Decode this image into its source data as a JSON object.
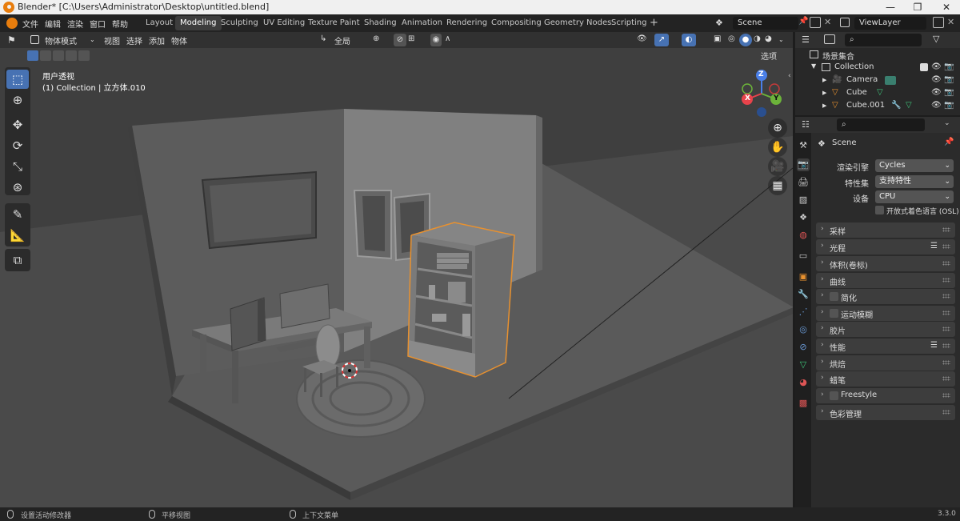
{
  "window": {
    "title": "Blender* [C:\\Users\\Administrator\\Desktop\\untitled.blend]",
    "minimize": "—",
    "maximize": "❐",
    "close": "✕"
  },
  "menu": [
    "文件",
    "编辑",
    "渲染",
    "窗口",
    "帮助"
  ],
  "workspaces": [
    {
      "label": "Layout",
      "active": false
    },
    {
      "label": "Modeling",
      "active": true
    },
    {
      "label": "Sculpting",
      "active": false
    },
    {
      "label": "UV Editing",
      "active": false
    },
    {
      "label": "Texture Paint",
      "active": false
    },
    {
      "label": "Shading",
      "active": false
    },
    {
      "label": "Animation",
      "active": false
    },
    {
      "label": "Rendering",
      "active": false
    },
    {
      "label": "Compositing",
      "active": false
    },
    {
      "label": "Geometry Nodes",
      "active": false
    },
    {
      "label": "Scripting",
      "active": false
    }
  ],
  "add_workspace": "+",
  "scene_name": "Scene",
  "view_layer": "ViewLayer",
  "viewport_header": {
    "mode": "物体模式",
    "view": "视图",
    "select": "选择",
    "add": "添加",
    "object": "物体",
    "transform_orientation": "全局",
    "options": "选项"
  },
  "viewport_overlay": {
    "view_name": "用户透视",
    "collection_info": "(1) Collection | 立方体.010"
  },
  "gizmo": {
    "z": "Z",
    "x": "X",
    "y": "Y"
  },
  "outliner": {
    "root": "场景集合",
    "collection": "Collection",
    "items": [
      {
        "name": "Camera",
        "icon": "camera-icon"
      },
      {
        "name": "Cube",
        "icon": "mesh-icon"
      },
      {
        "name": "Cube.001",
        "icon": "mesh-icon"
      }
    ]
  },
  "properties": {
    "scene_label": "Scene",
    "render_engine_label": "渲染引擎",
    "render_engine": "Cycles",
    "feature_set_label": "特性集",
    "feature_set": "支持特性",
    "device_label": "设备",
    "device": "CPU",
    "osl_label": "开放式着色语言 (OSL)",
    "panels": [
      {
        "label": "采样",
        "checkbox": false,
        "list": false
      },
      {
        "label": "光程",
        "checkbox": false,
        "list": true
      },
      {
        "label": "体积(卷标)",
        "checkbox": false,
        "list": false
      },
      {
        "label": "曲线",
        "checkbox": false,
        "list": false
      },
      {
        "label": "简化",
        "checkbox": true,
        "list": false
      },
      {
        "label": "运动模糊",
        "checkbox": true,
        "list": false
      },
      {
        "label": "胶片",
        "checkbox": false,
        "list": false
      },
      {
        "label": "性能",
        "checkbox": false,
        "list": true
      },
      {
        "label": "烘焙",
        "checkbox": false,
        "list": false
      },
      {
        "label": "蜡笔",
        "checkbox": false,
        "list": false
      },
      {
        "label": "Freestyle",
        "checkbox": true,
        "list": false
      },
      {
        "label": "色彩管理",
        "checkbox": false,
        "list": false
      }
    ]
  },
  "statusbar": {
    "left_hint": "设置活动修改器",
    "middle_hint": "平移视图",
    "right_hint": "上下文菜单",
    "version": "3.3.0"
  },
  "colors": {
    "accent_blue": "#4772b3",
    "selection_orange": "#e8912f",
    "viewport_bg": "#3d3d3d"
  }
}
